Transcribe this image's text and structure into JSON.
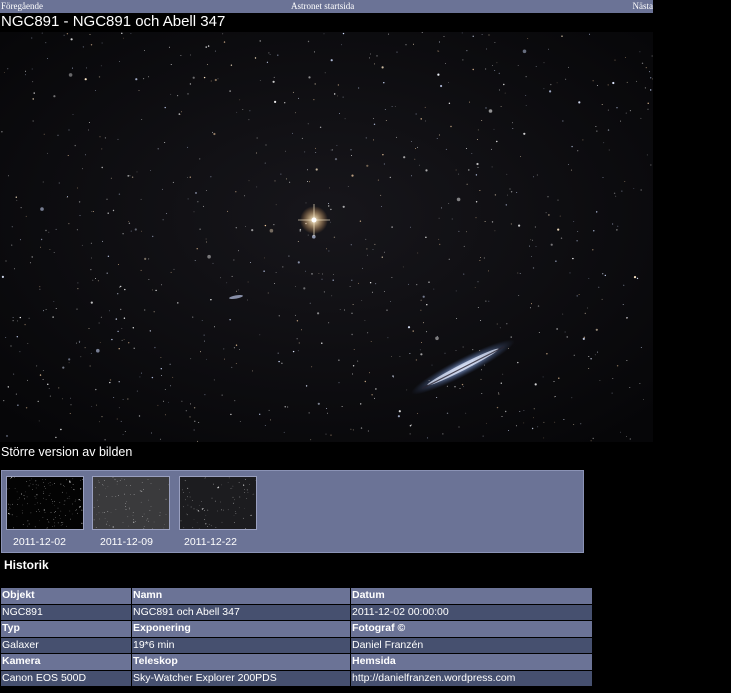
{
  "nav": {
    "previous": "Föregående",
    "home": "Astronet startsida",
    "next": "Nästa"
  },
  "title": "NGC891 - NGC891 och Abell 347",
  "larger_version_link": "Större version av bilden",
  "thumbnails": [
    {
      "date": "2011-12-02"
    },
    {
      "date": "2011-12-09"
    },
    {
      "date": "2011-12-22"
    }
  ],
  "history_heading": "Historik",
  "details": {
    "rows": [
      {
        "type": "header",
        "cells": [
          "Objekt",
          "Namn",
          "Datum"
        ]
      },
      {
        "type": "value",
        "cells": [
          "NGC891",
          "NGC891 och Abell 347",
          "2011-12-02 00:00:00"
        ]
      },
      {
        "type": "header",
        "cells": [
          "Typ",
          "Exponering",
          "Fotograf ©"
        ]
      },
      {
        "type": "value",
        "cells": [
          "Galaxer",
          "19*6 min",
          "Daniel Franzén"
        ]
      },
      {
        "type": "header",
        "cells": [
          "Kamera",
          "Teleskop",
          "Hemsida"
        ]
      },
      {
        "type": "value",
        "cells": [
          "Canon EOS 500D",
          "Sky-Watcher Explorer 200PDS",
          "http://danielfranzen.wordpress.com"
        ]
      }
    ]
  },
  "colors": {
    "panel_bg": "#6b7396",
    "value_row_bg": "#46506f",
    "page_bg": "#000000"
  }
}
